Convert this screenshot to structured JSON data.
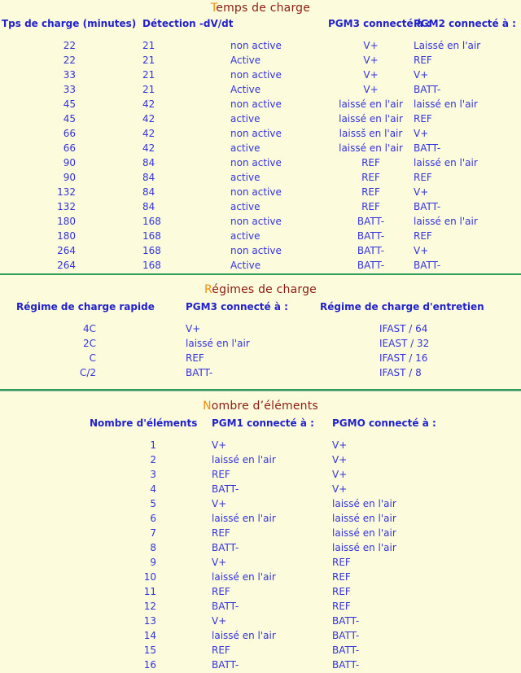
{
  "theme": {
    "background": "#FCFCDC",
    "text_blue": "#2222CC",
    "title_maroon": "#8C1A12",
    "title_initial_orange": "#F28A0C",
    "rule_green": "#2E9B5B"
  },
  "sections": [
    {
      "id": "charge-times",
      "title_initial": "T",
      "title_rest": "emps de charge",
      "title_full": "Temps de charge",
      "columns": [
        "Tps de charge (minutes)",
        "Détection -dV/dt",
        "",
        "PGM3 connecté à :",
        "PGM2 connecté à :"
      ],
      "rows": [
        [
          "22",
          "21",
          "non active",
          "V+",
          "Laissé en l'air"
        ],
        [
          "22",
          "21",
          "Active",
          "V+",
          "REF"
        ],
        [
          "33",
          "21",
          "non active",
          "V+",
          "V+"
        ],
        [
          "33",
          "21",
          "Active",
          "V+",
          "BATT-"
        ],
        [
          "45",
          "42",
          "non active",
          "laissé en l'air",
          "laissé en l'air"
        ],
        [
          "45",
          "42",
          "active",
          "laissé en l'air",
          "REF"
        ],
        [
          "66",
          "42",
          "non active",
          "laissš en l'air",
          "V+"
        ],
        [
          "66",
          "42",
          "active",
          "laissé en l'air",
          "BATT-"
        ],
        [
          "90",
          "84",
          "non active",
          "REF",
          "laissé en l'air"
        ],
        [
          "90",
          "84",
          "active",
          "REF",
          "REF"
        ],
        [
          "132",
          "84",
          "non active",
          "REF",
          "V+"
        ],
        [
          "132",
          "84",
          "active",
          "REF",
          "BATT-"
        ],
        [
          "180",
          "168",
          "non active",
          "BATT-",
          "laissé en l'air"
        ],
        [
          "180",
          "168",
          "active",
          "BATT-",
          "REF"
        ],
        [
          "264",
          "168",
          "non active",
          "BATT-",
          "V+"
        ],
        [
          "264",
          "168",
          "Active",
          "BATT-",
          "BATT-"
        ]
      ]
    },
    {
      "id": "regimes",
      "title_initial": "R",
      "title_rest": "égimes de charge",
      "title_full": "Régimes de charge",
      "columns": [
        "Régime de charge rapide",
        "PGM3 connecté à :",
        "Régime de charge d'entretien"
      ],
      "rows": [
        [
          "4C",
          "V+",
          "IFAST / 64"
        ],
        [
          "2C",
          "laissé en l'air",
          "IEAST / 32"
        ],
        [
          "C",
          "REF",
          "IFAST / 16"
        ],
        [
          "C/2",
          "BATT-",
          "IFAST / 8"
        ]
      ]
    },
    {
      "id": "cells",
      "title_initial": "N",
      "title_rest": "ombre d’éléments",
      "title_full": "Nombre d’éléments",
      "columns": [
        "Nombre d'éléments",
        "PGM1 connecté à :",
        "PGMO connecté à :"
      ],
      "rows": [
        [
          "1",
          "V+",
          "V+"
        ],
        [
          "2",
          "laissé en l'air",
          "V+"
        ],
        [
          "3",
          "REF",
          "V+"
        ],
        [
          "4",
          "BATT-",
          "V+"
        ],
        [
          "5",
          "V+",
          "laissé en l'air"
        ],
        [
          "6",
          "laissé en l'air",
          "laissé en l'air"
        ],
        [
          "7",
          "REF",
          "laissé en l'air"
        ],
        [
          "8",
          "BATT-",
          "laissé en l'air"
        ],
        [
          "9",
          "V+",
          "REF"
        ],
        [
          "10",
          "laissé en l'air",
          "REF"
        ],
        [
          "11",
          "REF",
          "REF"
        ],
        [
          "12",
          "BATT-",
          "REF"
        ],
        [
          "13",
          "V+",
          "BATT-"
        ],
        [
          "14",
          "laissé en l'air",
          "BATT-"
        ],
        [
          "15",
          "REF",
          "BATT-"
        ],
        [
          "16",
          "BATT-",
          "BATT-"
        ]
      ]
    }
  ]
}
